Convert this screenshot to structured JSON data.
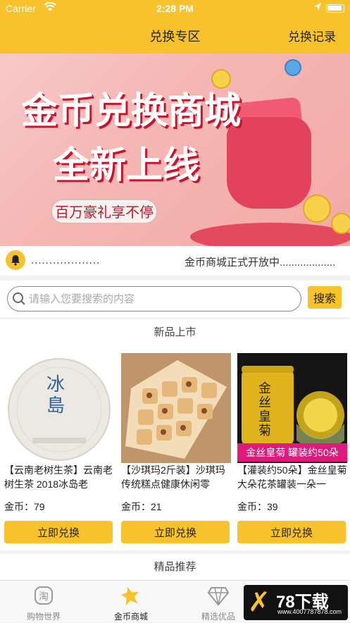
{
  "status_bar": {
    "carrier": "Carrier",
    "time": "2:28 PM"
  },
  "nav": {
    "title": "兑换专区",
    "right_action": "兑换记录"
  },
  "banner": {
    "line1": "金币兑换商城",
    "line2": "全新上线",
    "pill": "百万豪礼享不停"
  },
  "notice": {
    "dots": "...................",
    "text": "金币商城正式开放中..................."
  },
  "search": {
    "placeholder": "请输入您要搜索的内容",
    "value": "",
    "button": "搜索"
  },
  "sections": {
    "new": "新品上市",
    "featured": "精品推荐"
  },
  "products": [
    {
      "name": "【云南老树生茶】云南老树生茶 2018冰岛老",
      "price": "金币：79",
      "button": "立即兑换",
      "img_text": "冰島"
    },
    {
      "name": "【沙琪玛2斤装】沙琪玛传统糕点健康休闲零",
      "price": "金币：21",
      "button": "立即兑换"
    },
    {
      "name": "【灌装约50朵】金丝皇菊大朵花茶罐装一朵一",
      "price": "金币：39",
      "button": "立即兑换",
      "img_text": "金丝皇菊",
      "img_banner": "金丝皇菊 罐装约50朵"
    }
  ],
  "tabs": [
    {
      "label": "购物世界",
      "icon": "taobao-icon"
    },
    {
      "label": "金币商城",
      "icon": "star-icon"
    },
    {
      "label": "精选优品",
      "icon": "diamond-icon"
    },
    {
      "label": "",
      "icon": "user-icon"
    }
  ],
  "watermark": {
    "brand": "78下载",
    "url": "www.4007787878.com"
  },
  "colors": {
    "accent": "#f8c22d",
    "banner_red": "#c8142c"
  }
}
